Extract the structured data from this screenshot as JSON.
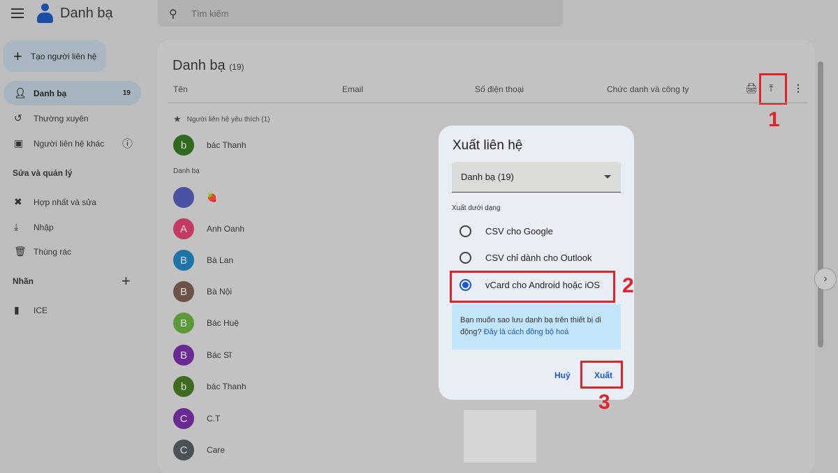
{
  "app": {
    "title": "Danh bạ",
    "search_placeholder": "Tìm kiếm"
  },
  "sidebar": {
    "create_label": "Tạo người liên hệ",
    "items": [
      {
        "label": "Danh bạ",
        "count": "19"
      },
      {
        "label": "Thường xuyên"
      },
      {
        "label": "Người liên hệ khác"
      }
    ],
    "manage_heading": "Sửa và quản lý",
    "manage_items": [
      {
        "label": "Hợp nhất và sửa"
      },
      {
        "label": "Nhập"
      },
      {
        "label": "Thùng rác"
      }
    ],
    "labels_heading": "Nhãn",
    "labels": [
      {
        "label": "ICE"
      }
    ]
  },
  "main": {
    "title": "Danh bạ",
    "count": "(19)",
    "columns": [
      "Tên",
      "Email",
      "Số điện thoại",
      "Chức danh và công ty"
    ],
    "favorites_heading": "Người liên hệ yêu thích (1)",
    "favorites": [
      {
        "initial": "b",
        "name": "bác Thanh",
        "color": "#2f6b1f"
      }
    ],
    "contacts_heading": "Danh bạ",
    "contacts": [
      {
        "initial": "",
        "name": "🍓",
        "color": "#4a52a3"
      },
      {
        "initial": "A",
        "name": "Anh Oanh",
        "color": "#c43a63"
      },
      {
        "initial": "B",
        "name": "Bà Lan",
        "color": "#1c74a8"
      },
      {
        "initial": "B",
        "name": "Bà Nội",
        "color": "#6f5247"
      },
      {
        "initial": "B",
        "name": "Bác Huệ",
        "color": "#5a9a3a"
      },
      {
        "initial": "B",
        "name": "Bác Sĩ",
        "color": "#6b2a93"
      },
      {
        "initial": "b",
        "name": "bác Thanh",
        "color": "#3e6b1f"
      },
      {
        "initial": "C",
        "name": "C.T",
        "color": "#6b2a93"
      },
      {
        "initial": "C",
        "name": "Care",
        "color": "#4a5258"
      }
    ]
  },
  "dialog": {
    "title": "Xuất liên hệ",
    "select_value": "Danh bạ (19)",
    "format_label": "Xuất dưới dạng",
    "options": [
      {
        "label": "CSV cho Google",
        "selected": false
      },
      {
        "label": "CSV chỉ dành cho Outlook",
        "selected": false
      },
      {
        "label": "vCard cho Android hoặc iOS",
        "selected": true
      }
    ],
    "info_text": "Bạn muốn sao lưu danh bạ trên thiết bị di động?",
    "info_link": "Đây là cách đồng bộ hoá",
    "cancel_label": "Huỷ",
    "export_label": "Xuất"
  },
  "annotations": [
    "1",
    "2",
    "3"
  ]
}
